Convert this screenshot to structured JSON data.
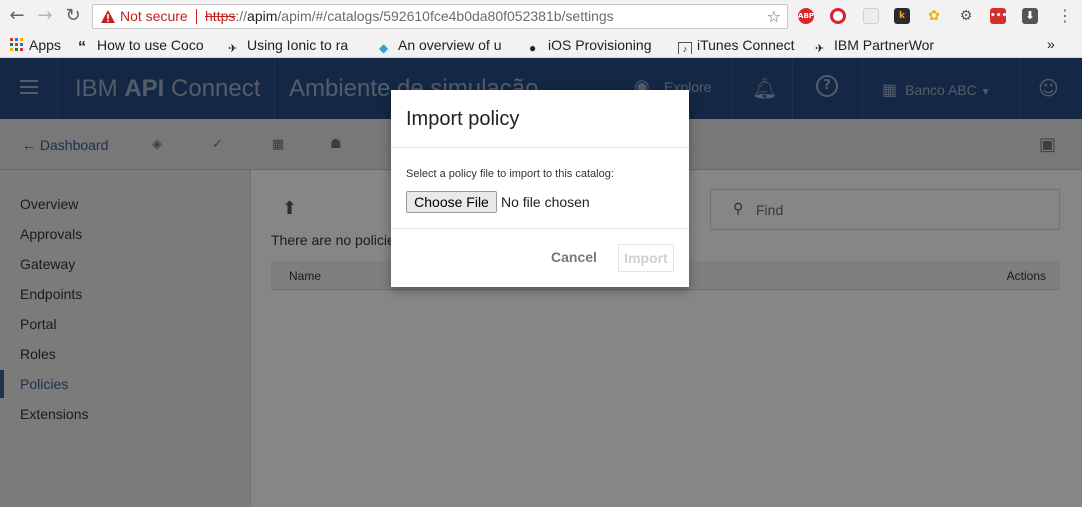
{
  "browser": {
    "security_label": "Not secure",
    "url": {
      "scheme": "https",
      "rest": "://",
      "host": "apim",
      "path": "/apim/#/catalogs/592610fce4b0da80f052381b/settings"
    },
    "bookmarks": [
      {
        "label": "Apps",
        "icon": "apps-grid-icon"
      },
      {
        "label": "How to use Coco",
        "icon": "quote-icon"
      },
      {
        "label": "Using Ionic to ra",
        "icon": "ionic-icon"
      },
      {
        "label": "An overview of u",
        "icon": "cube-icon"
      },
      {
        "label": "iOS Provisioning",
        "icon": "apple-icon"
      },
      {
        "label": "iTunes Connect",
        "icon": "itunes-icon"
      },
      {
        "label": "IBM PartnerWor",
        "icon": "ibm-icon"
      }
    ],
    "more_label": "»",
    "extensions": [
      "ABP"
    ]
  },
  "header": {
    "brand_prefix": "IBM ",
    "brand_bold": "API",
    "brand_suffix": " Connect",
    "catalog": "Ambiente de simulação",
    "explore_label": "Explore",
    "org_label": "Banco ABC"
  },
  "toolbar": {
    "back_label": "Dashboard"
  },
  "nav": {
    "items": [
      "Overview",
      "Approvals",
      "Gateway",
      "Endpoints",
      "Portal",
      "Roles",
      "Policies",
      "Extensions"
    ],
    "active": "Policies"
  },
  "main": {
    "empty_text": "There are no policie",
    "search_placeholder": "Find",
    "columns": {
      "name": "Name",
      "actions": "Actions"
    }
  },
  "dialog": {
    "title": "Import policy",
    "prompt": "Select a policy file to import to this catalog:",
    "file_button": "Choose File",
    "file_status": "No file chosen",
    "cancel_label": "Cancel",
    "import_label": "Import"
  },
  "colors": {
    "header_bg": "#264a7f",
    "accent": "#3b5a8e",
    "warning": "#c5221f"
  }
}
